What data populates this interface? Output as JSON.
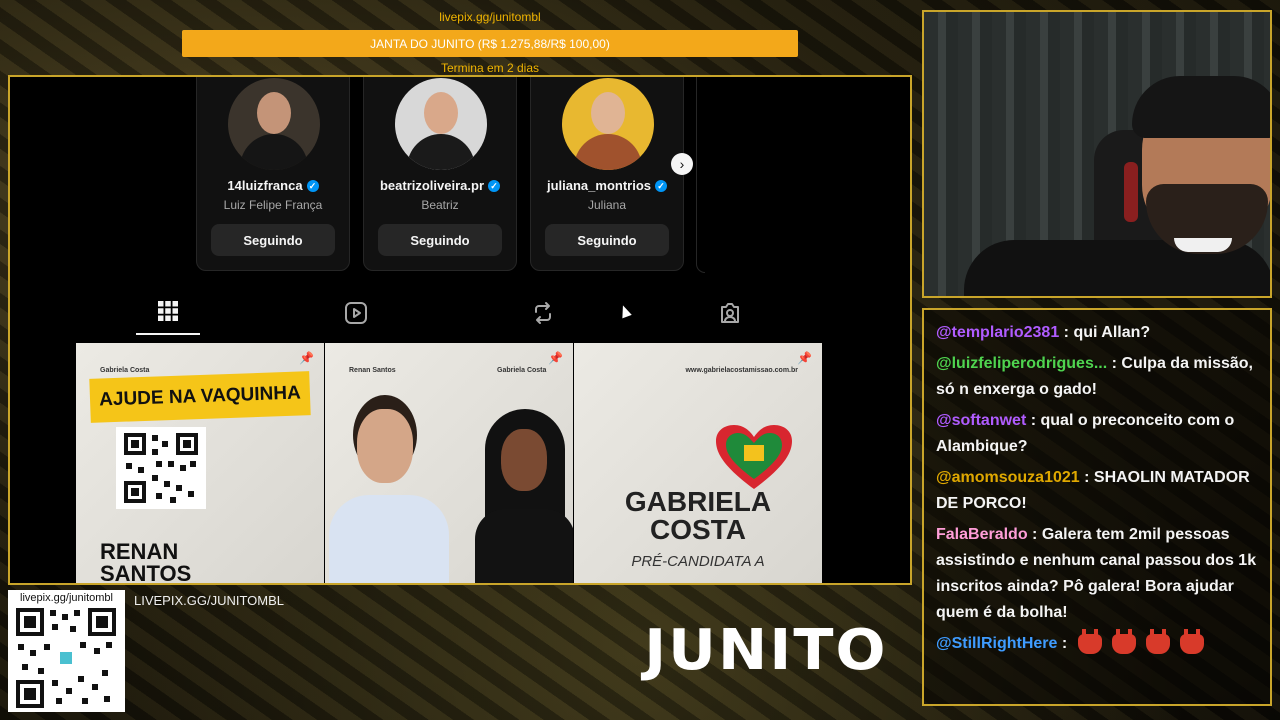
{
  "goal": {
    "url": "livepix.gg/junitombl",
    "label": "JANTA DO JUNITO (R$ 1.275,88/R$ 100,00)",
    "ends": "Termina em 2 dias"
  },
  "suggested_accounts": [
    {
      "username": "14luizfranca",
      "full_name": "Luiz Felipe França",
      "button": "Seguindo"
    },
    {
      "username": "beatrizoliveira.pr",
      "full_name": "Beatriz",
      "button": "Seguindo"
    },
    {
      "username": "juliana_montrios",
      "full_name": "Juliana",
      "button": "Seguindo"
    }
  ],
  "tabs": [
    "posts-grid-icon",
    "reels-icon",
    "reposts-icon",
    "tagged-icon"
  ],
  "posts": {
    "post1": {
      "label": "Gabriela Costa",
      "banner": "AJUDE NA VAQUINHA",
      "name_line1": "RENAN",
      "name_line2": "SANTOS"
    },
    "post2": {
      "label_left": "Renan Santos",
      "label_right": "Gabriela Costa"
    },
    "post3": {
      "site": "www.gabrielacostamissao.com.br",
      "title_line1": "GABRIELA",
      "title_line2": "COSTA",
      "subtitle": "PRÉ-CANDIDATA A"
    }
  },
  "overlay": {
    "qr_url": "livepix.gg/junitombl",
    "livepix_text": "LIVEPIX.GG/JUNITOMBL",
    "logo": "JUNITO"
  },
  "chat": [
    {
      "user": "@templario2381",
      "color": "#b05cff",
      "text": " : qui Allan?"
    },
    {
      "user": "@luizfeliperodrigues...",
      "color": "#4fd44f",
      "text": " : Culpa da missão, só n enxerga o gado!"
    },
    {
      "user": "@softanwet",
      "color": "#b05cff",
      "text": " : qual o preconceito com o Alambique?"
    },
    {
      "user": "@amomsouza1021",
      "color": "#e0a800",
      "text": " : SHAOLIN MATADOR DE PORCO!"
    },
    {
      "user": "FalaBeraldo",
      "color": "#ff9ed8",
      "text": " : Galera tem 2mil pessoas assistindo e nenhum canal passou dos 1k inscritos ainda? Pô galera! Bora ajudar quem é da bolha!"
    },
    {
      "user": "@StillRightHere",
      "color": "#3f9cff",
      "text": " : ",
      "emotes": 4
    }
  ],
  "colors": {
    "goal_bar": "#f3a81a",
    "frame": "#c9a52a",
    "verified": "#0095f6"
  }
}
